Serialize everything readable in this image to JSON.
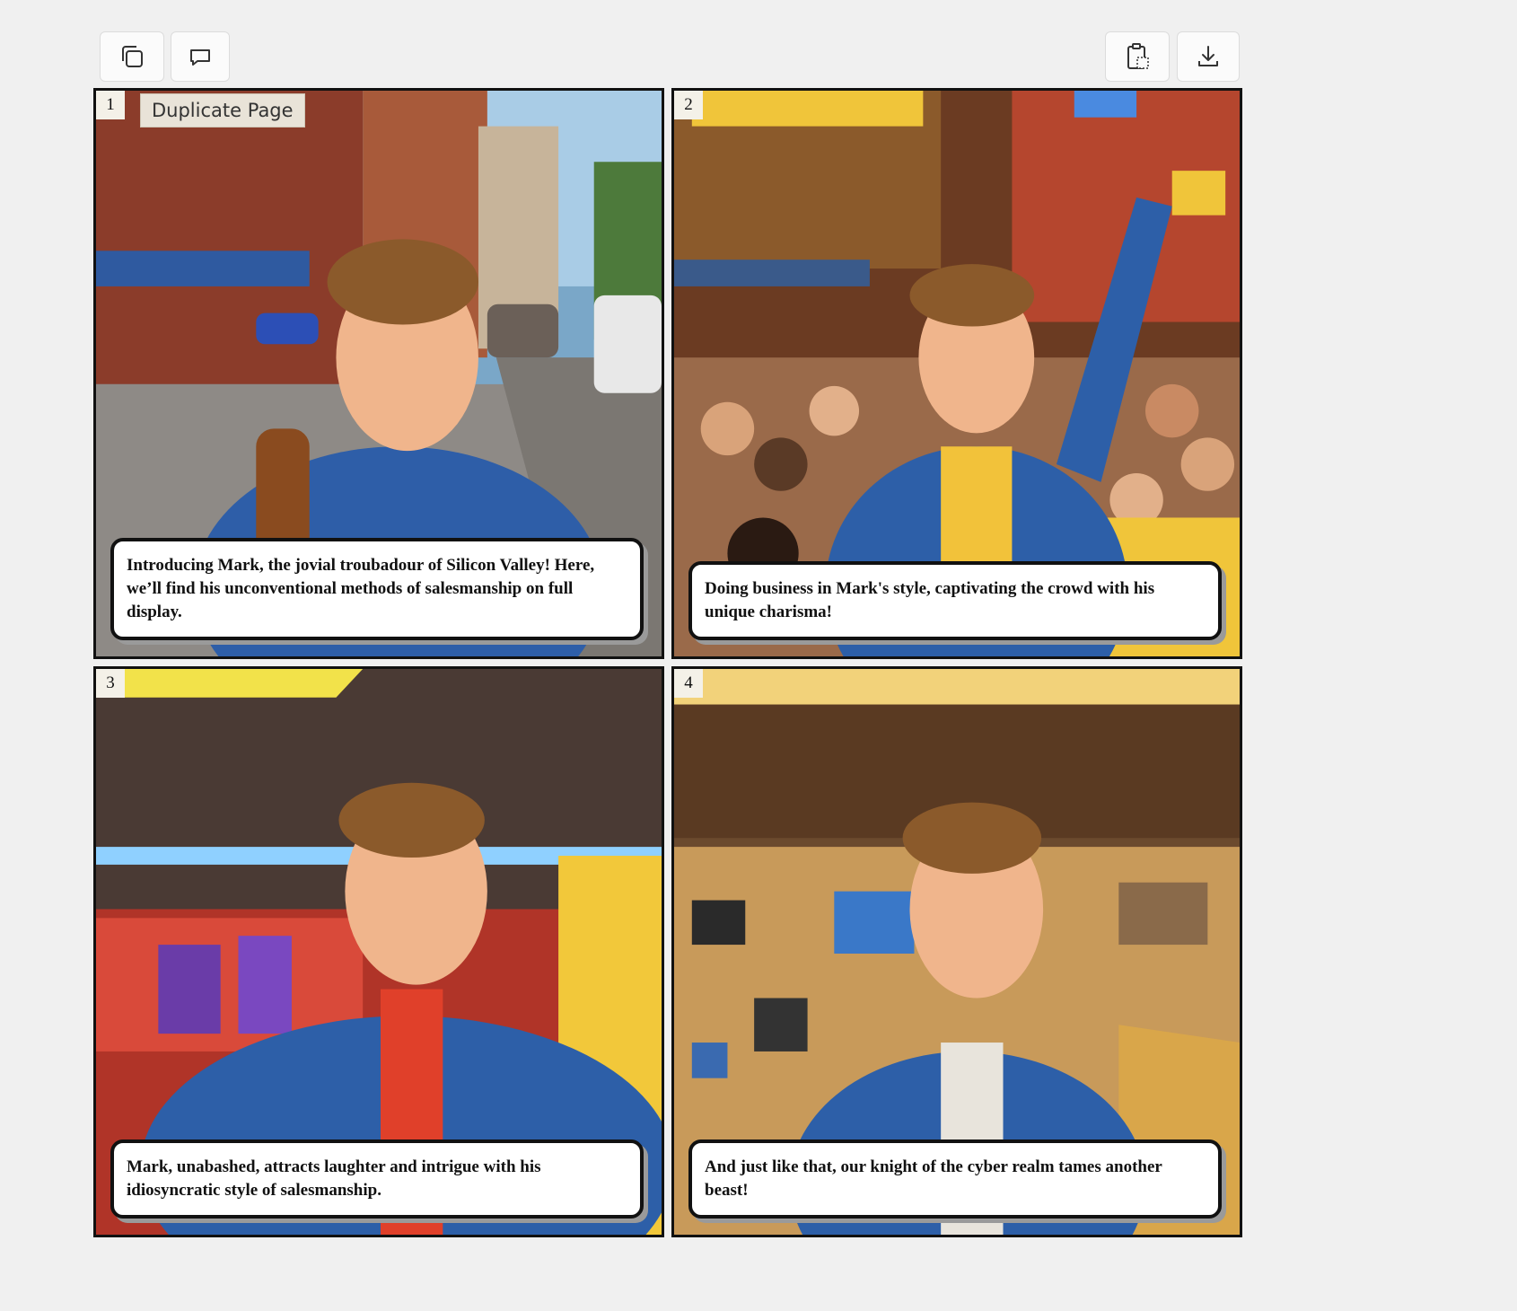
{
  "toolbar": {
    "left": [
      {
        "icon": "duplicate-icon"
      },
      {
        "icon": "comment-icon"
      }
    ],
    "right": [
      {
        "icon": "clipboard-icon"
      },
      {
        "icon": "download-icon"
      }
    ]
  },
  "tooltip": "Duplicate Page",
  "panels": [
    {
      "number": "1",
      "caption": "Introducing Mark, the jovial troubadour of Silicon Valley! Here, we’ll find his unconventional methods of salesmanship on full display."
    },
    {
      "number": "2",
      "caption": "Doing business in Mark's style, captivating the crowd with his unique charisma!"
    },
    {
      "number": "3",
      "caption": "Mark, unabashed, attracts laughter and intrigue with his idiosyncratic style of salesmanship."
    },
    {
      "number": "4",
      "caption": "And just like that, our knight of the cyber realm tames another beast!"
    }
  ]
}
